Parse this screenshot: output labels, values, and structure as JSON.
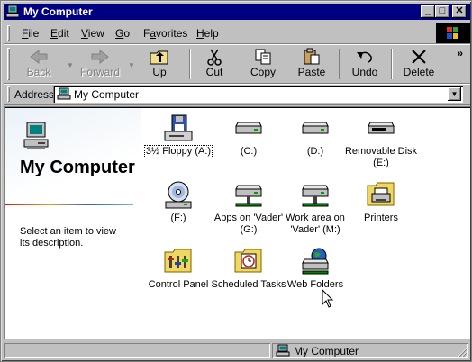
{
  "window": {
    "title": "My Computer"
  },
  "titlebar_buttons": {
    "minimize": "_",
    "maximize": "□",
    "close": "✕"
  },
  "menu": {
    "items": [
      {
        "pre": "",
        "key": "F",
        "post": "ile"
      },
      {
        "pre": "",
        "key": "E",
        "post": "dit"
      },
      {
        "pre": "",
        "key": "V",
        "post": "iew"
      },
      {
        "pre": "",
        "key": "G",
        "post": "o"
      },
      {
        "pre": "F",
        "key": "a",
        "post": "vorites"
      },
      {
        "pre": "",
        "key": "H",
        "post": "elp"
      }
    ]
  },
  "toolbar": {
    "back": "Back",
    "forward": "Forward",
    "up": "Up",
    "cut": "Cut",
    "copy": "Copy",
    "paste": "Paste",
    "undo": "Undo",
    "delete": "Delete",
    "more": "»"
  },
  "address": {
    "label": "Address",
    "value": "My Computer"
  },
  "sidebar": {
    "title": "My Computer",
    "description": "Select an item to view its description."
  },
  "items": [
    {
      "label": "3½ Floppy (A:)",
      "icon": "floppy-drive-icon"
    },
    {
      "label": "(C:)",
      "icon": "hard-drive-icon"
    },
    {
      "label": "(D:)",
      "icon": "hard-drive-icon"
    },
    {
      "label": "Removable Disk (E:)",
      "icon": "removable-disk-icon"
    },
    {
      "label": "(F:)",
      "icon": "cd-drive-icon"
    },
    {
      "label": "Apps on 'Vader' (G:)",
      "icon": "network-drive-icon"
    },
    {
      "label": "Work area on 'Vader' (M:)",
      "icon": "network-drive-icon"
    },
    {
      "label": "Printers",
      "icon": "printers-folder-icon"
    },
    {
      "label": "Control Panel",
      "icon": "control-panel-icon"
    },
    {
      "label": "Scheduled Tasks",
      "icon": "scheduled-tasks-icon"
    },
    {
      "label": "Web Folders",
      "icon": "web-folders-icon"
    }
  ],
  "status": {
    "location": "My Computer"
  },
  "colors": {
    "titlebar": "#000080",
    "face": "#c0c0c0",
    "window": "#ffffff"
  }
}
